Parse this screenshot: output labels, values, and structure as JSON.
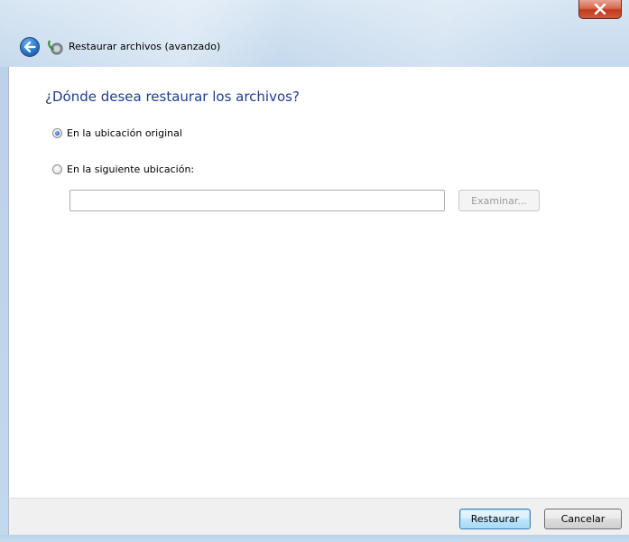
{
  "window": {
    "title": "Restaurar archivos (avanzado)",
    "close_label": "x"
  },
  "main": {
    "heading": "¿Dónde desea restaurar los archivos?",
    "options": [
      {
        "label": "En la ubicación original",
        "selected": true
      },
      {
        "label": "En la siguiente ubicación:",
        "selected": false
      }
    ],
    "location_input": {
      "value": "",
      "placeholder": ""
    },
    "browse_label": "Examinar..."
  },
  "footer": {
    "restore_label": "Restaurar",
    "cancel_label": "Cancelar"
  },
  "icons": {
    "back": "back-arrow-icon",
    "app": "restore-files-icon",
    "close": "close-icon"
  },
  "colors": {
    "heading": "#1e3d8f",
    "close_button": "#c2391b",
    "back_button": "#2b74c7",
    "default_button_border": "#3c7fb1"
  }
}
